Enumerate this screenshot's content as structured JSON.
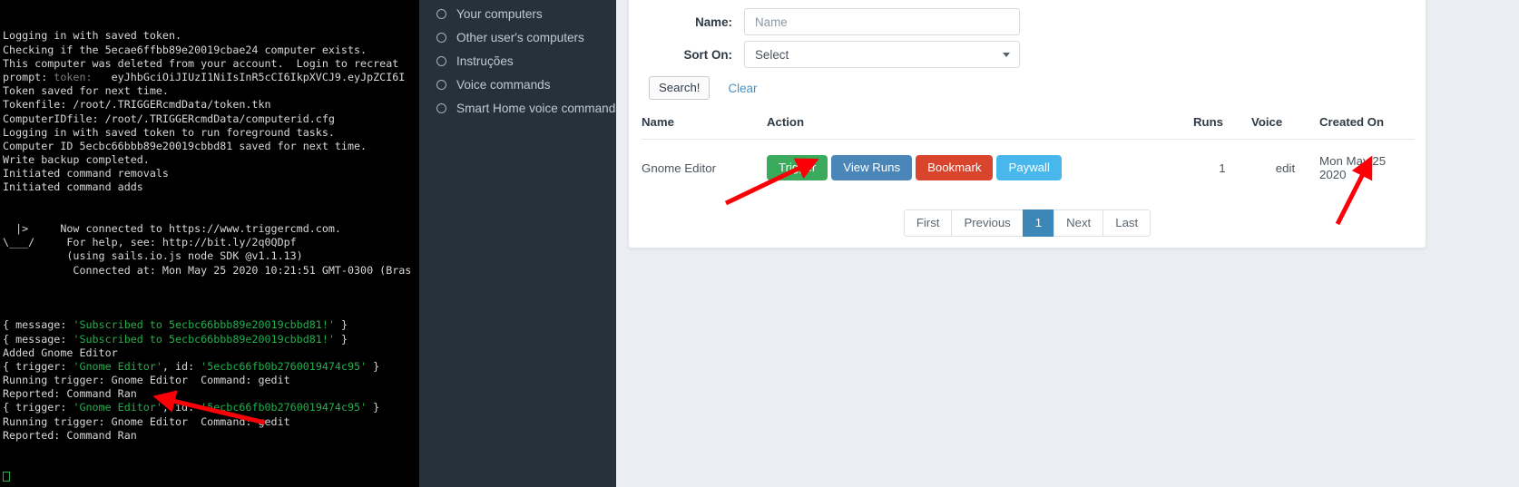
{
  "terminal": {
    "lines": [
      {
        "segments": [
          {
            "t": "Logging in with saved token.",
            "c": "plain"
          }
        ]
      },
      {
        "segments": [
          {
            "t": "Checking if the 5ecae6ffbb89e20019cbae24 computer exists.",
            "c": "plain"
          }
        ]
      },
      {
        "segments": [
          {
            "t": "This computer was deleted from your account.  Login to recreat",
            "c": "plain"
          }
        ]
      },
      {
        "segments": [
          {
            "t": "prompt: ",
            "c": "plain"
          },
          {
            "t": "token:",
            "c": "dim"
          },
          {
            "t": "   eyJhbGciOiJIUzI1NiIsInR5cCI6IkpXVCJ9.eyJpZCI6I",
            "c": "plain"
          }
        ]
      },
      {
        "segments": [
          {
            "t": "Token saved for next time.",
            "c": "plain"
          }
        ]
      },
      {
        "segments": [
          {
            "t": "Tokenfile: /root/.TRIGGERcmdData/token.tkn",
            "c": "plain"
          }
        ]
      },
      {
        "segments": [
          {
            "t": "ComputerIDfile: /root/.TRIGGERcmdData/computerid.cfg",
            "c": "plain"
          }
        ]
      },
      {
        "segments": [
          {
            "t": "Logging in with saved token to run foreground tasks.",
            "c": "plain"
          }
        ]
      },
      {
        "segments": [
          {
            "t": "Computer ID 5ecbc66bbb89e20019cbbd81 saved for next time.",
            "c": "plain"
          }
        ]
      },
      {
        "segments": [
          {
            "t": "Write backup completed.",
            "c": "plain"
          }
        ]
      },
      {
        "segments": [
          {
            "t": "Initiated command removals",
            "c": "plain"
          }
        ]
      },
      {
        "segments": [
          {
            "t": "Initiated command adds",
            "c": "plain"
          }
        ]
      },
      {
        "segments": [
          {
            "t": "",
            "c": "plain"
          }
        ]
      },
      {
        "segments": [
          {
            "t": "",
            "c": "plain"
          }
        ]
      },
      {
        "segments": [
          {
            "t": "  |>     Now connected to https://www.triggercmd.com.",
            "c": "plain"
          }
        ]
      },
      {
        "segments": [
          {
            "t": "\\___/     For help, see: http://bit.ly/2q0QDpf",
            "c": "plain"
          }
        ]
      },
      {
        "segments": [
          {
            "t": "          (using sails.io.js node SDK @v1.1.13)",
            "c": "plain"
          }
        ]
      },
      {
        "segments": [
          {
            "t": "           Connected at: Mon May 25 2020 10:21:51 GMT-0300 (Bras",
            "c": "plain"
          }
        ]
      },
      {
        "segments": [
          {
            "t": "",
            "c": "plain"
          }
        ]
      },
      {
        "segments": [
          {
            "t": "",
            "c": "plain"
          }
        ]
      },
      {
        "segments": [
          {
            "t": "",
            "c": "plain"
          }
        ]
      },
      {
        "segments": [
          {
            "t": "{ message: ",
            "c": "plain"
          },
          {
            "t": "'Subscribed to 5ecbc66bbb89e20019cbbd81!'",
            "c": "g"
          },
          {
            "t": " }",
            "c": "plain"
          }
        ]
      },
      {
        "segments": [
          {
            "t": "{ message: ",
            "c": "plain"
          },
          {
            "t": "'Subscribed to 5ecbc66bbb89e20019cbbd81!'",
            "c": "g"
          },
          {
            "t": " }",
            "c": "plain"
          }
        ]
      },
      {
        "segments": [
          {
            "t": "Added Gnome Editor",
            "c": "plain"
          }
        ]
      },
      {
        "segments": [
          {
            "t": "{ trigger: ",
            "c": "plain"
          },
          {
            "t": "'Gnome Editor'",
            "c": "g"
          },
          {
            "t": ", id: ",
            "c": "plain"
          },
          {
            "t": "'5ecbc66fb0b2760019474c95'",
            "c": "g"
          },
          {
            "t": " }",
            "c": "plain"
          }
        ]
      },
      {
        "segments": [
          {
            "t": "Running trigger: Gnome Editor  Command: gedit",
            "c": "plain"
          }
        ]
      },
      {
        "segments": [
          {
            "t": "Reported: Command Ran",
            "c": "plain"
          }
        ]
      },
      {
        "segments": [
          {
            "t": "{ trigger: ",
            "c": "plain"
          },
          {
            "t": "'Gnome Editor'",
            "c": "g"
          },
          {
            "t": ", id: ",
            "c": "plain"
          },
          {
            "t": "'5ecbc66fb0b2760019474c95'",
            "c": "g"
          },
          {
            "t": " }",
            "c": "plain"
          }
        ]
      },
      {
        "segments": [
          {
            "t": "Running trigger: Gnome Editor  Command: gedit",
            "c": "plain"
          }
        ]
      },
      {
        "segments": [
          {
            "t": "Reported: Command Ran",
            "c": "plain"
          }
        ]
      }
    ],
    "cursor": "cursor-block",
    "colors": {
      "background": "#000000",
      "text": "#d8d8d8",
      "green": "#22b14c",
      "dim": "#7d7d7d"
    }
  },
  "sidebar": {
    "background": "#27313a",
    "items": [
      {
        "label": "Your computers",
        "icon": "circle-icon"
      },
      {
        "label": "Other user's computers",
        "icon": "circle-icon"
      },
      {
        "label": "Instruções",
        "icon": "circle-icon"
      },
      {
        "label": "Voice commands",
        "icon": "circle-icon"
      },
      {
        "label": "Smart Home voice commands",
        "icon": "circle-icon"
      }
    ]
  },
  "search_form": {
    "name_label": "Name:",
    "name_value": "",
    "name_placeholder": "Name",
    "sort_label": "Sort On:",
    "sort_value": "Select",
    "sort_options": [
      "Select"
    ],
    "search_button": "Search!",
    "clear_link": "Clear"
  },
  "table": {
    "headers": [
      "Name",
      "Action",
      "Runs",
      "Voice",
      "Created On"
    ],
    "rows": [
      {
        "name": "Gnome Editor",
        "actions": [
          {
            "label": "Trigger",
            "color": "#3aaa5d",
            "style": "green"
          },
          {
            "label": "View Runs",
            "color": "#4a87b8",
            "style": "blue"
          },
          {
            "label": "Bookmark",
            "color": "#d9442d",
            "style": "red"
          },
          {
            "label": "Paywall",
            "color": "#48b8ec",
            "style": "lblue"
          }
        ],
        "runs": "1",
        "voice": "edit",
        "created_on": "Mon May 25 2020"
      }
    ]
  },
  "pagination": {
    "buttons": [
      {
        "label": "First",
        "active": false
      },
      {
        "label": "Previous",
        "active": false
      },
      {
        "label": "1",
        "active": true
      },
      {
        "label": "Next",
        "active": false
      },
      {
        "label": "Last",
        "active": false
      }
    ],
    "active_color": "#3d86b8"
  },
  "annotations": {
    "arrow_color": "#fb0007",
    "arrows": [
      {
        "name": "arrow-to-trigger-button"
      },
      {
        "name": "arrow-to-reported-command-ran"
      },
      {
        "name": "arrow-to-created-on-date"
      }
    ]
  }
}
